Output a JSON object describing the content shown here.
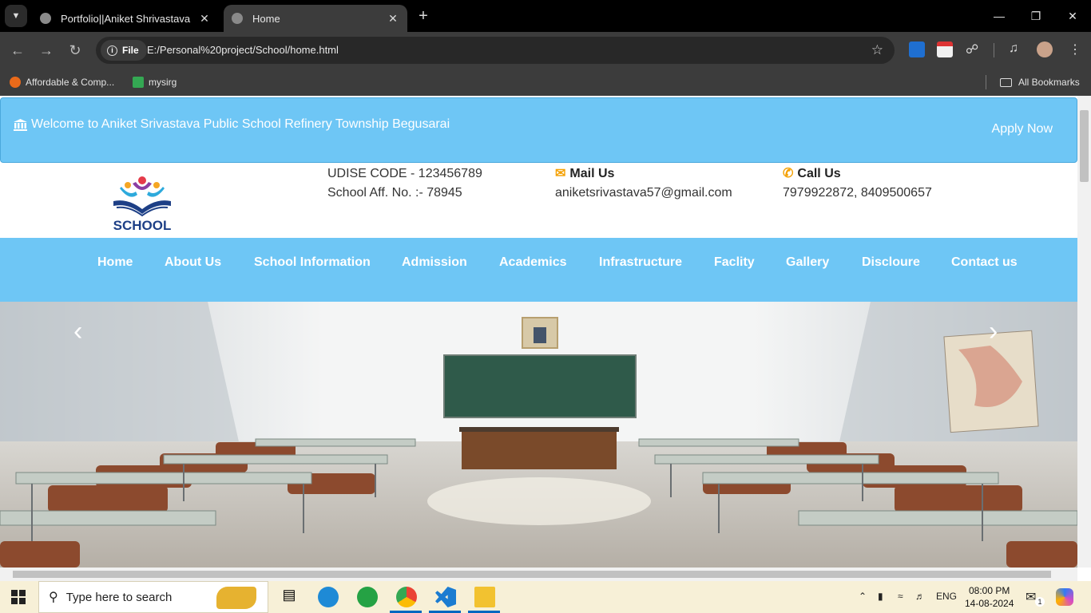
{
  "browser": {
    "tabs": [
      {
        "title": "Portfolio||Aniket Shrivastava",
        "active": false
      },
      {
        "title": "Home",
        "active": true
      }
    ],
    "site_chip": "File",
    "url": "E:/Personal%20project/School/home.html",
    "bookmarks": [
      {
        "label": "Affordable & Comp...",
        "icon_color": "#ea6a1a"
      },
      {
        "label": "mysirg",
        "icon_color": "#34a853"
      }
    ],
    "all_bookmarks": "All Bookmarks"
  },
  "site": {
    "welcome": "Welcome to Aniket Srivastava Public School Refinery Township Begusarai",
    "apply_now": "Apply Now",
    "logo_text": "SCHOOL",
    "udise": "UDISE CODE - 123456789",
    "affiliation": "School Aff. No. :- 78945",
    "mail_heading": "Mail Us",
    "mail": "aniketsrivastava57@gmail.com",
    "call_heading": "Call Us",
    "phones": "7979922872, 8409500657",
    "nav": [
      "Home",
      "About Us",
      "School Information",
      "Admission",
      "Academics",
      "Infrastructure",
      "Faclity",
      "Gallery",
      "Discloure",
      "Contact us"
    ],
    "colors": {
      "accent": "#6ec6f5",
      "icon": "#f4a000"
    }
  },
  "taskbar": {
    "search_placeholder": "Type here to search",
    "language": "ENG",
    "time": "08:00 PM",
    "date": "14-08-2024",
    "notification_count": "1"
  }
}
